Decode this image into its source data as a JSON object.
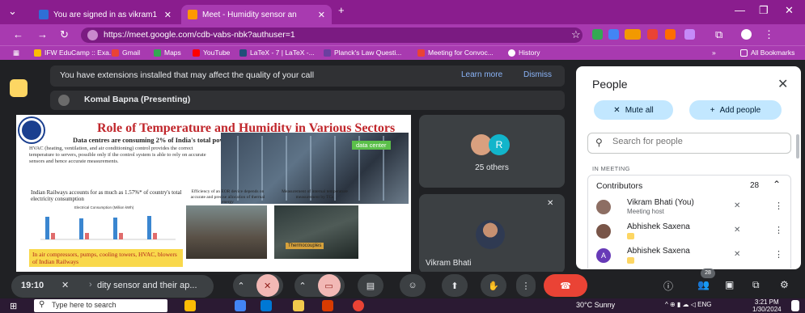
{
  "browser": {
    "tabs": [
      {
        "title": "You are signed in as vikram1",
        "favicon_color": "#2f6fd6"
      },
      {
        "title": "Meet - Humidity sensor an",
        "favicon_color": "#ff9800"
      }
    ],
    "new_tab_icon": "plus-icon",
    "url": "https://meet.google.com/cdb-vabs-nbk?authuser=1",
    "bookmarks": [
      {
        "label": "IFW EduCamp :: Exa...",
        "color": "#fbbc05"
      },
      {
        "label": "Gmail",
        "color": "#ea4335"
      },
      {
        "label": "Maps",
        "color": "#34a853"
      },
      {
        "label": "YouTube",
        "color": "#ff0000"
      },
      {
        "label": "LaTeX - 7 | LaTeX -...",
        "color": "#1f4e79"
      },
      {
        "label": "Planck's Law Questi...",
        "color": "#6b3fa0"
      },
      {
        "label": "Meeting for Convoc...",
        "color": "#ea4335"
      },
      {
        "label": "History",
        "color": "#ffffff"
      }
    ],
    "all_bookmarks": "All Bookmarks",
    "more_bookmarks": "»"
  },
  "meet": {
    "banner": {
      "message": "You have extensions installed that may affect the quality of your call",
      "learn_more": "Learn more",
      "dismiss": "Dismiss"
    },
    "presenter": "Komal Bapna (Presenting)",
    "slide": {
      "title": "Role of Temperature and Humidity in Various Sectors",
      "subtitle": "Data centres are consuming 2% of India's total power",
      "paragraph": "HVAC (heating, ventilation, and air conditioning) control provides the correct temperature to servers, possible only if the control system is able to rely on accurate sensors and hence accurate measurements.",
      "data_center_label": "data center",
      "railways_note": "Indian Railways accounts for as much as 1.57%* of country's total electricity consumption",
      "chart_title": "Electrical Consumption (Million kWh)",
      "caption_2": "Efficiency of an EOR device depends on accurate and precise allocation of thermal energy",
      "caption_3": "Measurement of internal temperature measurement by TCs",
      "thermocouples_label": "Thermocouples",
      "hvac_note": "In air compressors, pumps, cooling towers, HVAC, blowers of Indian Railways"
    },
    "tiles": {
      "others_initial": "R",
      "others_label": "25 others",
      "vikram_label": "Vikram Bhati"
    },
    "people_panel": {
      "title": "People",
      "mute_all": "Mute all",
      "add_people": "Add people",
      "search_placeholder": "Search for people",
      "section": "IN MEETING",
      "group": "Contributors",
      "count": "28",
      "participants": [
        {
          "name": "Vikram Bhati (You)",
          "sub": "Meeting host",
          "avatar_color": "#8d6e63",
          "initial": ""
        },
        {
          "name": "Abhishek Saxena",
          "sub": "",
          "avatar_color": "#795548",
          "initial": ""
        },
        {
          "name": "Abhishek Saxena",
          "sub": "",
          "avatar_color": "#673ab7",
          "initial": "A"
        }
      ]
    },
    "controls": {
      "time": "19:10",
      "meeting_title": "dity sensor and their ap...",
      "participants_badge": "28"
    }
  },
  "taskbar": {
    "search_placeholder": "Type here to search",
    "weather": "30°C Sunny",
    "language": "ENG",
    "time": "3:21 PM",
    "date": "1/30/2024"
  }
}
